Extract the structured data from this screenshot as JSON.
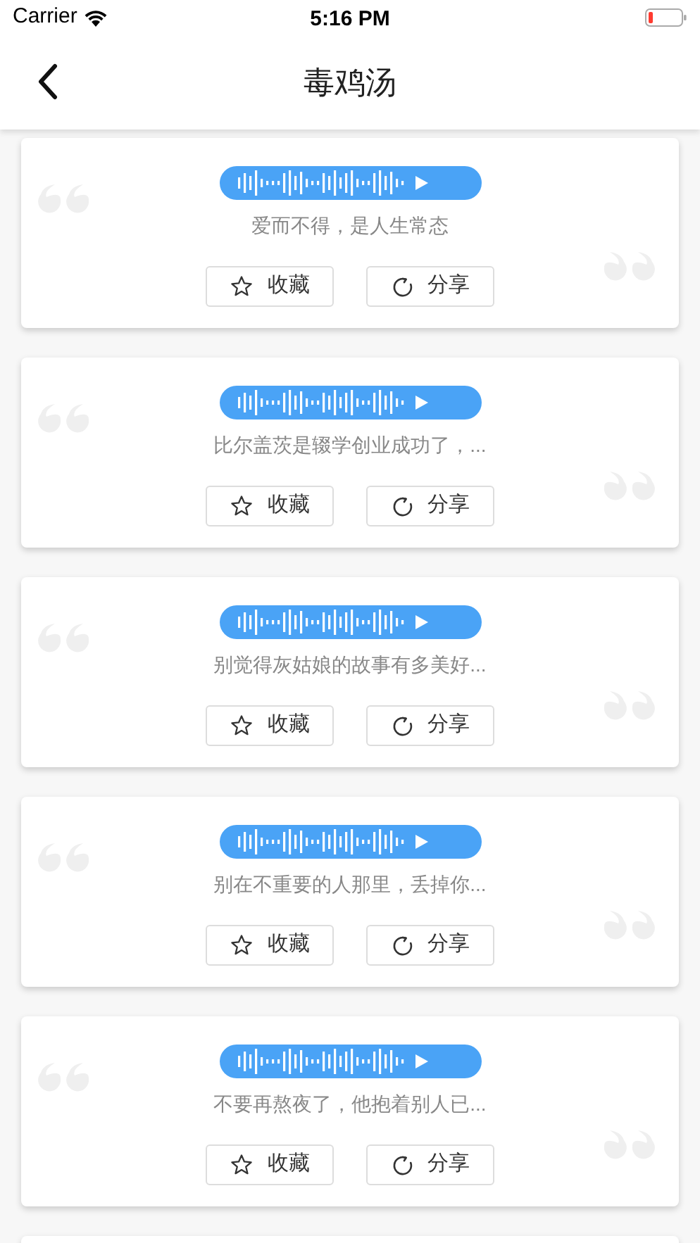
{
  "status_bar": {
    "carrier": "Carrier",
    "time": "5:16 PM"
  },
  "nav": {
    "title": "毒鸡汤"
  },
  "cards": [
    {
      "text": "爱而不得，是人生常态",
      "buttons": [
        "收藏",
        "分享"
      ]
    },
    {
      "text": "比尔盖茨是辍学创业成功了，...",
      "buttons": [
        "收藏",
        "分享"
      ]
    },
    {
      "text": "别觉得灰姑娘的故事有多美好...",
      "buttons": [
        "收藏",
        "分享"
      ]
    },
    {
      "text": "别在不重要的人那里，丢掉你...",
      "buttons": [
        "收藏",
        "分享"
      ]
    },
    {
      "text": "不要再熬夜了，他抱着别人已...",
      "buttons": [
        "收藏",
        "分享"
      ]
    }
  ]
}
